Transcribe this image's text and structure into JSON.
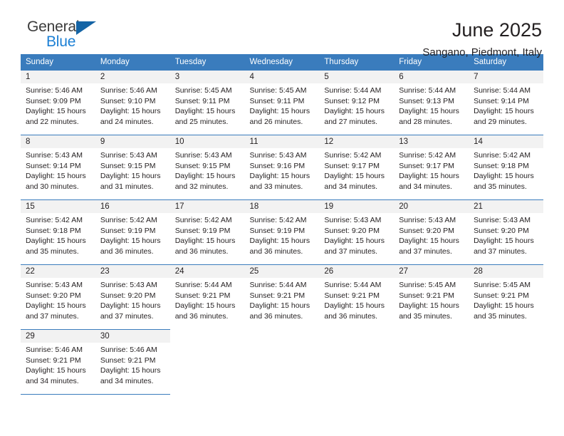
{
  "logo": {
    "word_one": "General",
    "word_two": "Blue",
    "flag_icon": "triangle-flag-icon"
  },
  "header": {
    "title": "June 2025",
    "subtitle": "Sangano, Piedmont, Italy"
  },
  "colors": {
    "header_blue": "#3a7cbd",
    "logo_blue": "#1b7fd4",
    "logo_flag_blue": "#1464a5",
    "daynum_band": "#f2f2f2",
    "text": "#231f20"
  },
  "calendar": {
    "weekday_headers": [
      "Sunday",
      "Monday",
      "Tuesday",
      "Wednesday",
      "Thursday",
      "Friday",
      "Saturday"
    ],
    "weeks": [
      [
        {
          "day": "1",
          "sunrise": "Sunrise: 5:46 AM",
          "sunset": "Sunset: 9:09 PM",
          "daylight_1": "Daylight: 15 hours",
          "daylight_2": "and 22 minutes."
        },
        {
          "day": "2",
          "sunrise": "Sunrise: 5:46 AM",
          "sunset": "Sunset: 9:10 PM",
          "daylight_1": "Daylight: 15 hours",
          "daylight_2": "and 24 minutes."
        },
        {
          "day": "3",
          "sunrise": "Sunrise: 5:45 AM",
          "sunset": "Sunset: 9:11 PM",
          "daylight_1": "Daylight: 15 hours",
          "daylight_2": "and 25 minutes."
        },
        {
          "day": "4",
          "sunrise": "Sunrise: 5:45 AM",
          "sunset": "Sunset: 9:11 PM",
          "daylight_1": "Daylight: 15 hours",
          "daylight_2": "and 26 minutes."
        },
        {
          "day": "5",
          "sunrise": "Sunrise: 5:44 AM",
          "sunset": "Sunset: 9:12 PM",
          "daylight_1": "Daylight: 15 hours",
          "daylight_2": "and 27 minutes."
        },
        {
          "day": "6",
          "sunrise": "Sunrise: 5:44 AM",
          "sunset": "Sunset: 9:13 PM",
          "daylight_1": "Daylight: 15 hours",
          "daylight_2": "and 28 minutes."
        },
        {
          "day": "7",
          "sunrise": "Sunrise: 5:44 AM",
          "sunset": "Sunset: 9:14 PM",
          "daylight_1": "Daylight: 15 hours",
          "daylight_2": "and 29 minutes."
        }
      ],
      [
        {
          "day": "8",
          "sunrise": "Sunrise: 5:43 AM",
          "sunset": "Sunset: 9:14 PM",
          "daylight_1": "Daylight: 15 hours",
          "daylight_2": "and 30 minutes."
        },
        {
          "day": "9",
          "sunrise": "Sunrise: 5:43 AM",
          "sunset": "Sunset: 9:15 PM",
          "daylight_1": "Daylight: 15 hours",
          "daylight_2": "and 31 minutes."
        },
        {
          "day": "10",
          "sunrise": "Sunrise: 5:43 AM",
          "sunset": "Sunset: 9:15 PM",
          "daylight_1": "Daylight: 15 hours",
          "daylight_2": "and 32 minutes."
        },
        {
          "day": "11",
          "sunrise": "Sunrise: 5:43 AM",
          "sunset": "Sunset: 9:16 PM",
          "daylight_1": "Daylight: 15 hours",
          "daylight_2": "and 33 minutes."
        },
        {
          "day": "12",
          "sunrise": "Sunrise: 5:42 AM",
          "sunset": "Sunset: 9:17 PM",
          "daylight_1": "Daylight: 15 hours",
          "daylight_2": "and 34 minutes."
        },
        {
          "day": "13",
          "sunrise": "Sunrise: 5:42 AM",
          "sunset": "Sunset: 9:17 PM",
          "daylight_1": "Daylight: 15 hours",
          "daylight_2": "and 34 minutes."
        },
        {
          "day": "14",
          "sunrise": "Sunrise: 5:42 AM",
          "sunset": "Sunset: 9:18 PM",
          "daylight_1": "Daylight: 15 hours",
          "daylight_2": "and 35 minutes."
        }
      ],
      [
        {
          "day": "15",
          "sunrise": "Sunrise: 5:42 AM",
          "sunset": "Sunset: 9:18 PM",
          "daylight_1": "Daylight: 15 hours",
          "daylight_2": "and 35 minutes."
        },
        {
          "day": "16",
          "sunrise": "Sunrise: 5:42 AM",
          "sunset": "Sunset: 9:19 PM",
          "daylight_1": "Daylight: 15 hours",
          "daylight_2": "and 36 minutes."
        },
        {
          "day": "17",
          "sunrise": "Sunrise: 5:42 AM",
          "sunset": "Sunset: 9:19 PM",
          "daylight_1": "Daylight: 15 hours",
          "daylight_2": "and 36 minutes."
        },
        {
          "day": "18",
          "sunrise": "Sunrise: 5:42 AM",
          "sunset": "Sunset: 9:19 PM",
          "daylight_1": "Daylight: 15 hours",
          "daylight_2": "and 36 minutes."
        },
        {
          "day": "19",
          "sunrise": "Sunrise: 5:43 AM",
          "sunset": "Sunset: 9:20 PM",
          "daylight_1": "Daylight: 15 hours",
          "daylight_2": "and 37 minutes."
        },
        {
          "day": "20",
          "sunrise": "Sunrise: 5:43 AM",
          "sunset": "Sunset: 9:20 PM",
          "daylight_1": "Daylight: 15 hours",
          "daylight_2": "and 37 minutes."
        },
        {
          "day": "21",
          "sunrise": "Sunrise: 5:43 AM",
          "sunset": "Sunset: 9:20 PM",
          "daylight_1": "Daylight: 15 hours",
          "daylight_2": "and 37 minutes."
        }
      ],
      [
        {
          "day": "22",
          "sunrise": "Sunrise: 5:43 AM",
          "sunset": "Sunset: 9:20 PM",
          "daylight_1": "Daylight: 15 hours",
          "daylight_2": "and 37 minutes."
        },
        {
          "day": "23",
          "sunrise": "Sunrise: 5:43 AM",
          "sunset": "Sunset: 9:20 PM",
          "daylight_1": "Daylight: 15 hours",
          "daylight_2": "and 37 minutes."
        },
        {
          "day": "24",
          "sunrise": "Sunrise: 5:44 AM",
          "sunset": "Sunset: 9:21 PM",
          "daylight_1": "Daylight: 15 hours",
          "daylight_2": "and 36 minutes."
        },
        {
          "day": "25",
          "sunrise": "Sunrise: 5:44 AM",
          "sunset": "Sunset: 9:21 PM",
          "daylight_1": "Daylight: 15 hours",
          "daylight_2": "and 36 minutes."
        },
        {
          "day": "26",
          "sunrise": "Sunrise: 5:44 AM",
          "sunset": "Sunset: 9:21 PM",
          "daylight_1": "Daylight: 15 hours",
          "daylight_2": "and 36 minutes."
        },
        {
          "day": "27",
          "sunrise": "Sunrise: 5:45 AM",
          "sunset": "Sunset: 9:21 PM",
          "daylight_1": "Daylight: 15 hours",
          "daylight_2": "and 35 minutes."
        },
        {
          "day": "28",
          "sunrise": "Sunrise: 5:45 AM",
          "sunset": "Sunset: 9:21 PM",
          "daylight_1": "Daylight: 15 hours",
          "daylight_2": "and 35 minutes."
        }
      ],
      [
        {
          "day": "29",
          "sunrise": "Sunrise: 5:46 AM",
          "sunset": "Sunset: 9:21 PM",
          "daylight_1": "Daylight: 15 hours",
          "daylight_2": "and 34 minutes."
        },
        {
          "day": "30",
          "sunrise": "Sunrise: 5:46 AM",
          "sunset": "Sunset: 9:21 PM",
          "daylight_1": "Daylight: 15 hours",
          "daylight_2": "and 34 minutes."
        },
        null,
        null,
        null,
        null,
        null
      ]
    ]
  }
}
